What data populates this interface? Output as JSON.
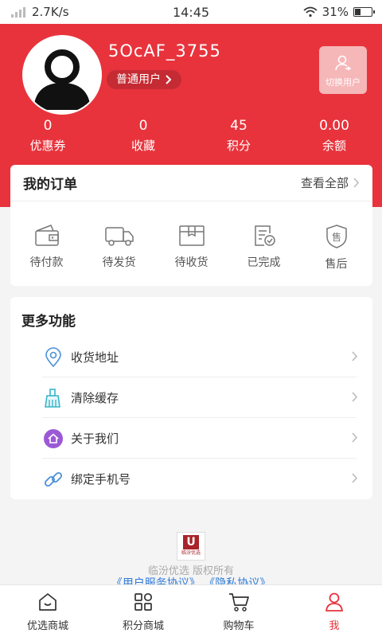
{
  "status_bar": {
    "network_speed": "2.7K/s",
    "time": "14:45",
    "battery": "31%"
  },
  "profile": {
    "username": "5OcAF_3755",
    "level": "普通用户",
    "switch_user_label": "切换用户",
    "stats": [
      {
        "value": "0",
        "label": "优惠券"
      },
      {
        "value": "0",
        "label": "收藏"
      },
      {
        "value": "45",
        "label": "积分"
      },
      {
        "value": "0.00",
        "label": "余额"
      }
    ]
  },
  "orders": {
    "title": "我的订单",
    "view_all": "查看全部",
    "items": [
      {
        "label": "待付款",
        "icon": "wallet-icon"
      },
      {
        "label": "待发货",
        "icon": "truck-icon"
      },
      {
        "label": "待收货",
        "icon": "package-icon"
      },
      {
        "label": "已完成",
        "icon": "checklist-icon"
      },
      {
        "label": "售后",
        "icon": "shield-after-sales-icon"
      }
    ]
  },
  "more": {
    "title": "更多功能",
    "items": [
      {
        "label": "收货地址",
        "icon": "location-pin-icon"
      },
      {
        "label": "清除缓存",
        "icon": "broom-icon"
      },
      {
        "label": "关于我们",
        "icon": "house-badge-icon"
      },
      {
        "label": "绑定手机号",
        "icon": "link-icon"
      }
    ]
  },
  "footer": {
    "logo_letter": "U",
    "logo_text": "临汾优选",
    "copyright": "临汾优选 版权所有",
    "agreements": "《用户服务协议》 《隐私协议》"
  },
  "tabbar": [
    {
      "label": "优选商城",
      "icon": "home-icon"
    },
    {
      "label": "积分商城",
      "icon": "grid-icon"
    },
    {
      "label": "购物车",
      "icon": "cart-icon"
    },
    {
      "label": "我",
      "icon": "user-icon"
    }
  ],
  "colors": {
    "brand_red": "#e8333c",
    "link_blue": "#2f7bd9"
  }
}
